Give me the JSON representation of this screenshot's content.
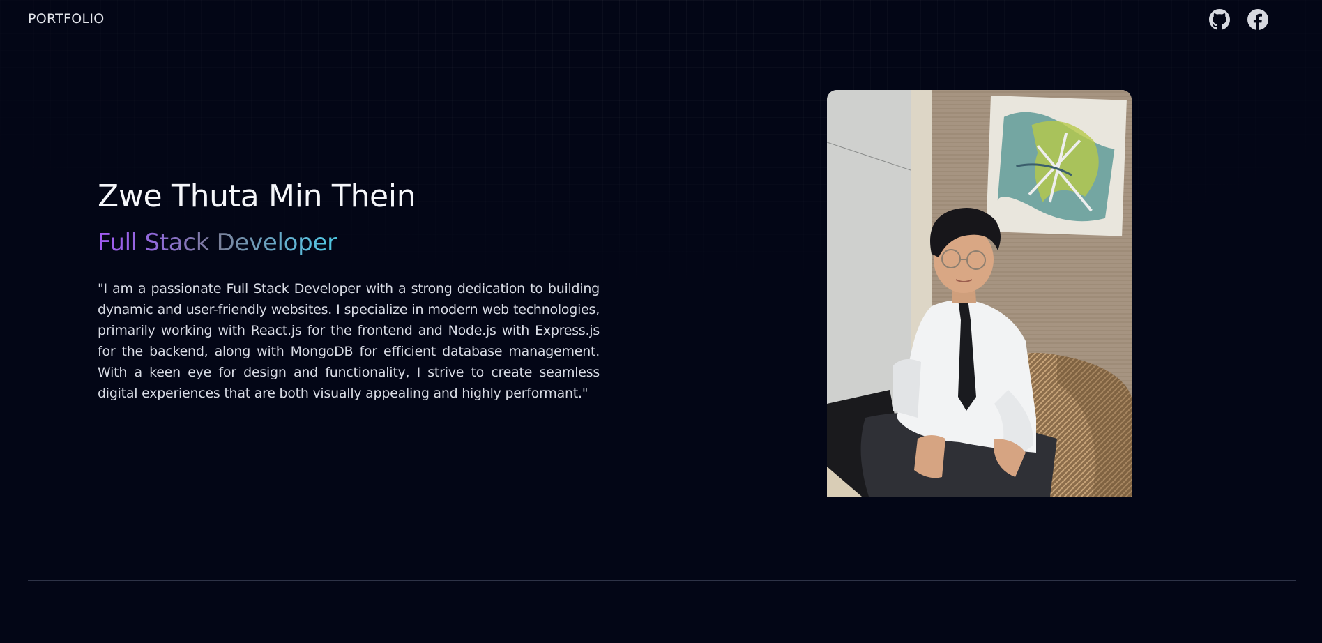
{
  "nav": {
    "brand": "PORTFOLIO",
    "links": [
      {
        "icon": "github-icon"
      },
      {
        "icon": "facebook-icon"
      }
    ]
  },
  "hero": {
    "name": "Zwe Thuta Min Thein",
    "role": "Full Stack Developer",
    "bio": "\"I am a passionate Full Stack Developer with a strong dedication to building dynamic and user-friendly websites. I specialize in modern web technologies, primarily working with React.js for the frontend and Node.js with Express.js for the backend, along with MongoDB for efficient database management. With a keen eye for design and functionality, I strive to create seamless digital experiences that are both visually appealing and highly performant.\"",
    "role_gradient": [
      "#a259f3",
      "#7b8099",
      "#4ec6e0"
    ]
  },
  "colors": {
    "background": "#030616",
    "text": "#f5f6fa",
    "body_text": "#d8dbe4",
    "divider": "#2e3347"
  }
}
